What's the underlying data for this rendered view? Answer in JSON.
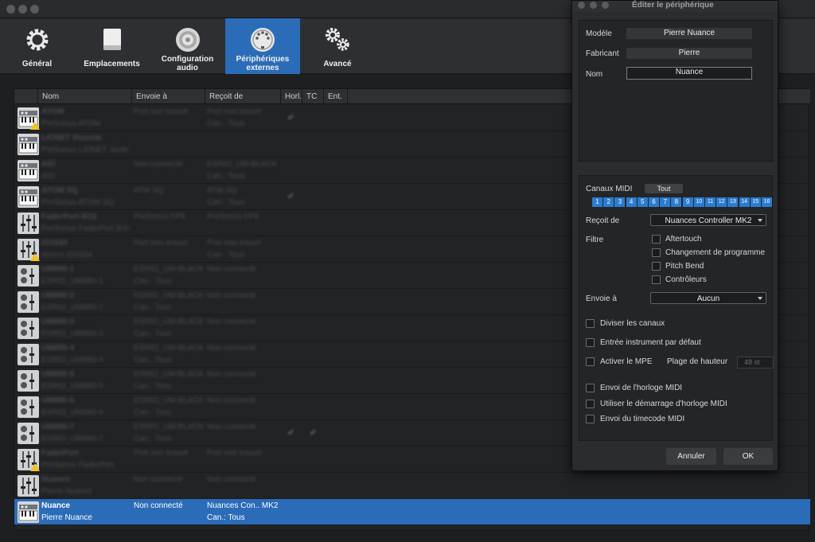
{
  "toolbar": {
    "items": [
      {
        "label": "Général",
        "icon": "gear-icon"
      },
      {
        "label": "Emplacements",
        "icon": "drive-icon"
      },
      {
        "label": "Configuration audio",
        "icon": "speaker-icon"
      },
      {
        "label": "Périphériques externes",
        "icon": "midi-port-icon",
        "active": true
      },
      {
        "label": "Avancé",
        "icon": "gears-icon"
      }
    ]
  },
  "table": {
    "headers": [
      "Nom",
      "Envoie à",
      "Reçoit de",
      "Horl.",
      "TC",
      "Ent."
    ],
    "rows": [
      {
        "icon": "keyboard",
        "warn": true,
        "name": "ATOM",
        "sub": "PreSonus ATOM",
        "send": "Port non trouvé",
        "recv": "Port non trouvé",
        "recv2": "Can.: Tous",
        "clock": true
      },
      {
        "icon": "keyboard",
        "name": "LIONET Remote",
        "sub": "PreSonus LIONET Joule",
        "send": "",
        "recv": "",
        "recv2": ""
      },
      {
        "icon": "keyboard",
        "name": "AIO",
        "sub": "AIO",
        "send": "Non connecté",
        "recv": "ESRIO_UM-BLACK",
        "recv2": "Can.: Tous"
      },
      {
        "icon": "keyboard",
        "name": "ATOM SQ",
        "sub": "PreSonus ATOM SQ",
        "send": "ATM SQ",
        "recv": "ATM SQ",
        "recv2": "Can.: Tous",
        "clock": true
      },
      {
        "icon": "faders",
        "name": "FaderPort 8/16",
        "sub": "PreSonus FaderPort 8/16",
        "send": "PreSonus FP8",
        "recv": "PreSonus FP8",
        "recv2": ""
      },
      {
        "icon": "faders",
        "warn": true,
        "name": "IO1634",
        "sub": "Atoms IO1634",
        "send": "Port non trouvé",
        "recv": "Port non trouvé",
        "recv2": "Can.: Tous"
      },
      {
        "icon": "knobs",
        "name": "UM880-1",
        "sub": "ESRIO_UM880-1",
        "send": "ESRIO_UM-BLACK",
        "send2": "Can.: Tous",
        "recv": "Non connecté",
        "recv2": ""
      },
      {
        "icon": "knobs",
        "name": "UM880-2",
        "sub": "ESRIO_UM880-2",
        "send": "ESRIO_UM-BLACK",
        "send2": "Can.: Tous",
        "recv": "Non connecté",
        "recv2": ""
      },
      {
        "icon": "knobs",
        "name": "UM880-3",
        "sub": "ESRIO_UM880-3",
        "send": "ESRIO_UM-BLACK",
        "send2": "Can.: Tous",
        "recv": "Non connecté",
        "recv2": ""
      },
      {
        "icon": "knobs",
        "name": "UM880-4",
        "sub": "ESRIO_UM880-4",
        "send": "ESRIO_UM-BLACK",
        "send2": "Can.: Tous",
        "recv": "Non connecté",
        "recv2": ""
      },
      {
        "icon": "knobs",
        "name": "UM880-5",
        "sub": "ESRIO_UM880-5",
        "send": "ESRIO_UM-BLACK",
        "send2": "Can.: Tous",
        "recv": "Non connecté",
        "recv2": ""
      },
      {
        "icon": "knobs",
        "name": "UM880-6",
        "sub": "ESRIO_UM880-6",
        "send": "ESRIO_UM-BLACK",
        "send2": "Can.: Tous",
        "recv": "Non connecté",
        "recv2": ""
      },
      {
        "icon": "knobs",
        "name": "UM880-7",
        "sub": "ESRIO_UM880-7",
        "send": "ESRIO_UM-BLACK",
        "send2": "Can.: Tous",
        "recv": "Non connecté",
        "recv2": "",
        "clock": true,
        "tc": true
      },
      {
        "icon": "faders",
        "warn": true,
        "name": "FaderPort",
        "sub": "PreSonus FaderPort",
        "send": "Port non trouvé",
        "recv": "Port non trouvé",
        "recv2": ""
      },
      {
        "icon": "faders",
        "name": "Nuance",
        "sub": "Pierre Nuance",
        "send": "Non connecté",
        "recv": "Non connecté",
        "recv2": ""
      },
      {
        "icon": "keyboard",
        "selected": true,
        "name": "Nuance",
        "sub": "Pierre Nuance",
        "send": "Non connecté",
        "recv": "Nuances Con.. MK2",
        "recv2": "Can.: Tous"
      }
    ]
  },
  "dialog": {
    "title": "Éditer le périphérique",
    "model_label": "Modèle",
    "model_value": "Pierre Nuance",
    "maker_label": "Fabricant",
    "maker_value": "Pierre",
    "name_label": "Nom",
    "name_value": "Nuance",
    "midi_label": "Canaux MIDI",
    "all_button": "Tout",
    "channels": [
      "1",
      "2",
      "3",
      "4",
      "5",
      "6",
      "7",
      "8",
      "9",
      "10",
      "11",
      "12",
      "13",
      "14",
      "15",
      "16"
    ],
    "receive_label": "Reçoit de",
    "receive_value": "Nuances Controller MK2",
    "filter_label": "Filtre",
    "filters": [
      "Aftertouch",
      "Changement de programme",
      "Pitch Bend",
      "Contrôleurs"
    ],
    "send_label": "Envoie à",
    "send_value": "Aucun",
    "split_label": "Diviser les canaux",
    "default_label": "Entrée instrument par défaut",
    "mpe_label": "Activer le MPE",
    "pitch_label": "Plage de hauteur",
    "pitch_value": "48 st",
    "clock_label": "Envoi de l'horloge MIDI",
    "clockstart_label": "Utiliser le démarrage d'horloge MIDI",
    "timecode_label": "Envoi du timecode MIDI",
    "cancel": "Annuler",
    "ok": "OK"
  }
}
